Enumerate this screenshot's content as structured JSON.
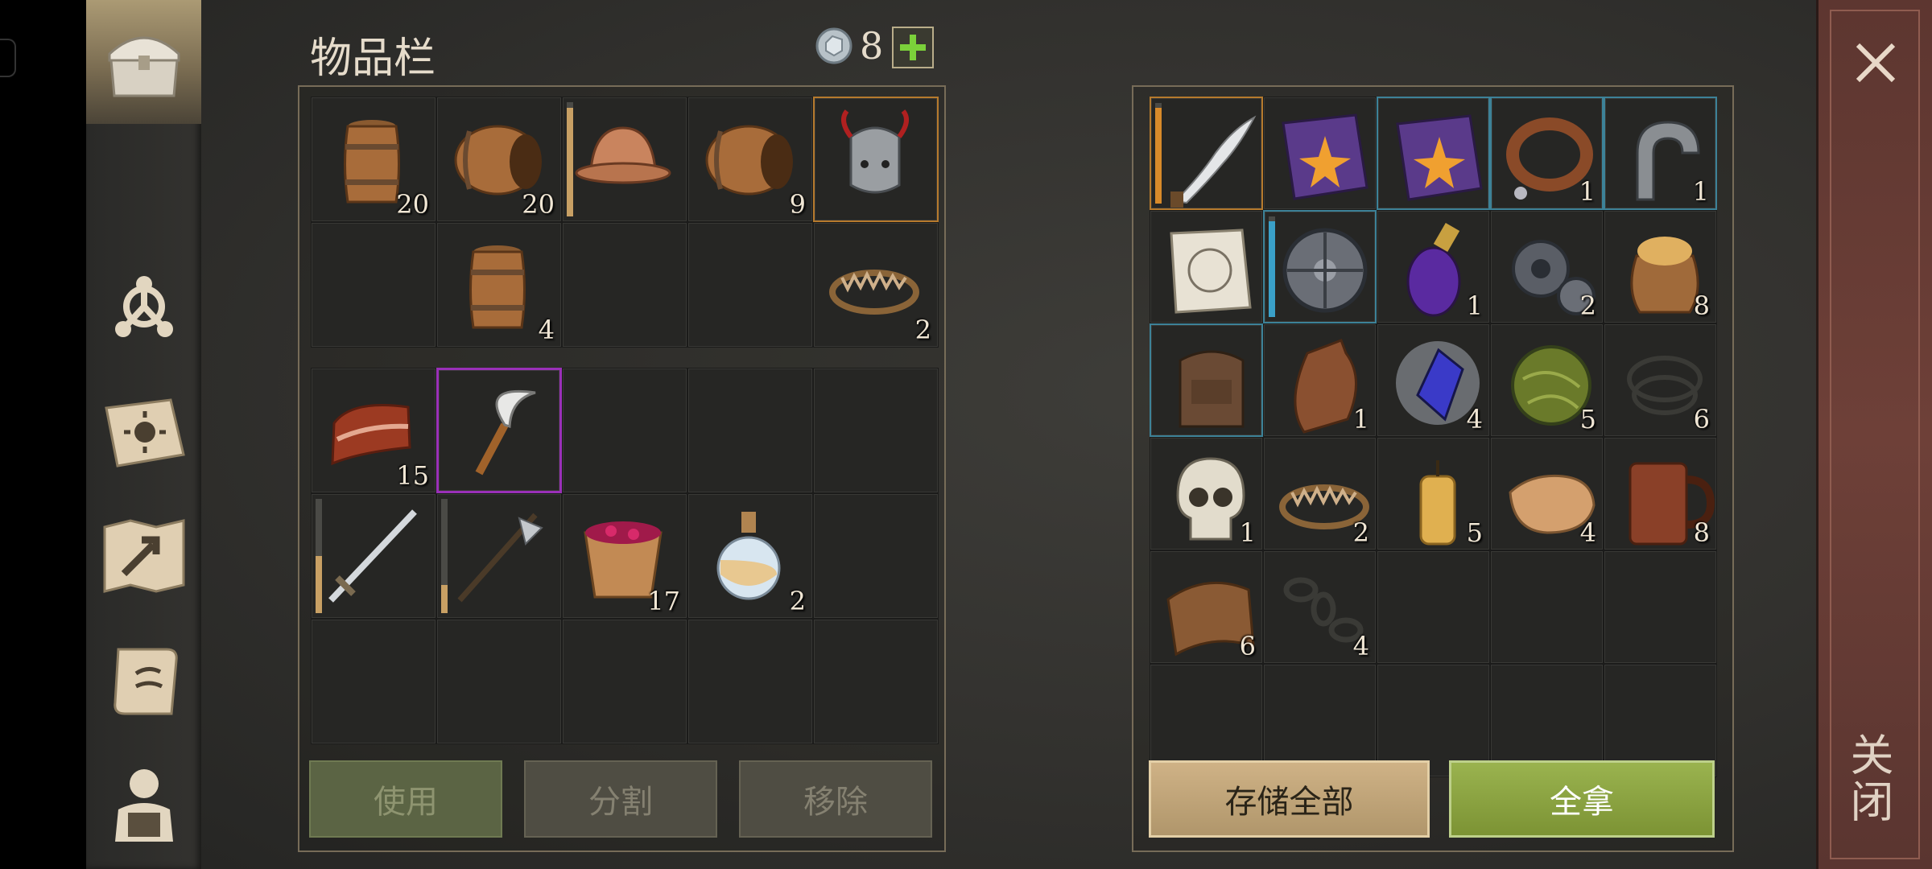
{
  "header": {
    "title": "物品栏",
    "currency_count": "8",
    "add_label": "+"
  },
  "side_menu": [
    "chest-icon",
    "crafting-icon",
    "skills-book-icon",
    "map-icon",
    "quests-scroll-icon",
    "character-equipment-icon"
  ],
  "close": {
    "label": "关闭"
  },
  "inventory": {
    "top_rows": [
      {
        "icon": "small-barrel",
        "qty": "20"
      },
      {
        "icon": "barrel-side",
        "qty": "20"
      },
      {
        "icon": "leather-helmet",
        "qty": "",
        "bar": 0.95
      },
      {
        "icon": "barrel-side",
        "qty": "9"
      },
      {
        "icon": "horned-helmet",
        "qty": "",
        "frame": "gold"
      },
      {
        "icon": "",
        "qty": ""
      },
      {
        "icon": "small-barrel",
        "qty": "4"
      },
      {
        "icon": "",
        "qty": ""
      },
      {
        "icon": "",
        "qty": ""
      },
      {
        "icon": "bear-trap",
        "qty": "2"
      }
    ],
    "bottom_rows": [
      {
        "icon": "bacon",
        "qty": "15"
      },
      {
        "icon": "sickle",
        "qty": "",
        "frame": "purple"
      },
      {
        "icon": "",
        "qty": ""
      },
      {
        "icon": "",
        "qty": ""
      },
      {
        "icon": "",
        "qty": ""
      },
      {
        "icon": "longsword",
        "qty": "",
        "bar": 0.5
      },
      {
        "icon": "halberd",
        "qty": "",
        "bar": 0.25
      },
      {
        "icon": "berry-bowl",
        "qty": "17"
      },
      {
        "icon": "potion-flask",
        "qty": "2"
      },
      {
        "icon": "",
        "qty": ""
      },
      {
        "icon": "",
        "qty": ""
      },
      {
        "icon": "",
        "qty": ""
      },
      {
        "icon": "",
        "qty": ""
      },
      {
        "icon": "",
        "qty": ""
      },
      {
        "icon": "",
        "qty": ""
      }
    ],
    "buttons": {
      "use": "使用",
      "split": "分割",
      "remove": "移除"
    }
  },
  "storage": {
    "slots": [
      {
        "icon": "curved-dagger",
        "qty": "",
        "frame": "gold",
        "bar": 0.95,
        "bar_color": "orange"
      },
      {
        "icon": "purple-book",
        "qty": ""
      },
      {
        "icon": "purple-book",
        "qty": "",
        "frame": "blue"
      },
      {
        "icon": "leather-collar",
        "qty": "1",
        "frame": "blue"
      },
      {
        "icon": "iron-shackle",
        "qty": "1",
        "frame": "blue"
      },
      {
        "icon": "blueprint-paper",
        "qty": ""
      },
      {
        "icon": "round-shield",
        "qty": "",
        "frame": "blue",
        "bar": 0.95,
        "bar_color": "blue"
      },
      {
        "icon": "mana-potion",
        "qty": "1"
      },
      {
        "icon": "gears",
        "qty": "2"
      },
      {
        "icon": "grain-sack",
        "qty": "8"
      },
      {
        "icon": "backpack",
        "qty": "",
        "frame": "blue"
      },
      {
        "icon": "leather-flask",
        "qty": "1"
      },
      {
        "icon": "blue-crystal",
        "qty": "4"
      },
      {
        "icon": "herb-ball",
        "qty": "5"
      },
      {
        "icon": "rope",
        "qty": "6"
      },
      {
        "icon": "skull",
        "qty": "1"
      },
      {
        "icon": "bear-trap",
        "qty": "2"
      },
      {
        "icon": "candle",
        "qty": "5"
      },
      {
        "icon": "cloth",
        "qty": "4"
      },
      {
        "icon": "wooden-mug",
        "qty": "8"
      },
      {
        "icon": "leather-scrap",
        "qty": "6"
      },
      {
        "icon": "chain",
        "qty": "4"
      },
      {
        "icon": "",
        "qty": ""
      },
      {
        "icon": "",
        "qty": ""
      },
      {
        "icon": "",
        "qty": ""
      },
      {
        "icon": "",
        "qty": ""
      },
      {
        "icon": "",
        "qty": ""
      },
      {
        "icon": "",
        "qty": ""
      },
      {
        "icon": "",
        "qty": ""
      },
      {
        "icon": "",
        "qty": ""
      }
    ],
    "buttons": {
      "store_all": "存储全部",
      "take_all": "全拿"
    }
  }
}
